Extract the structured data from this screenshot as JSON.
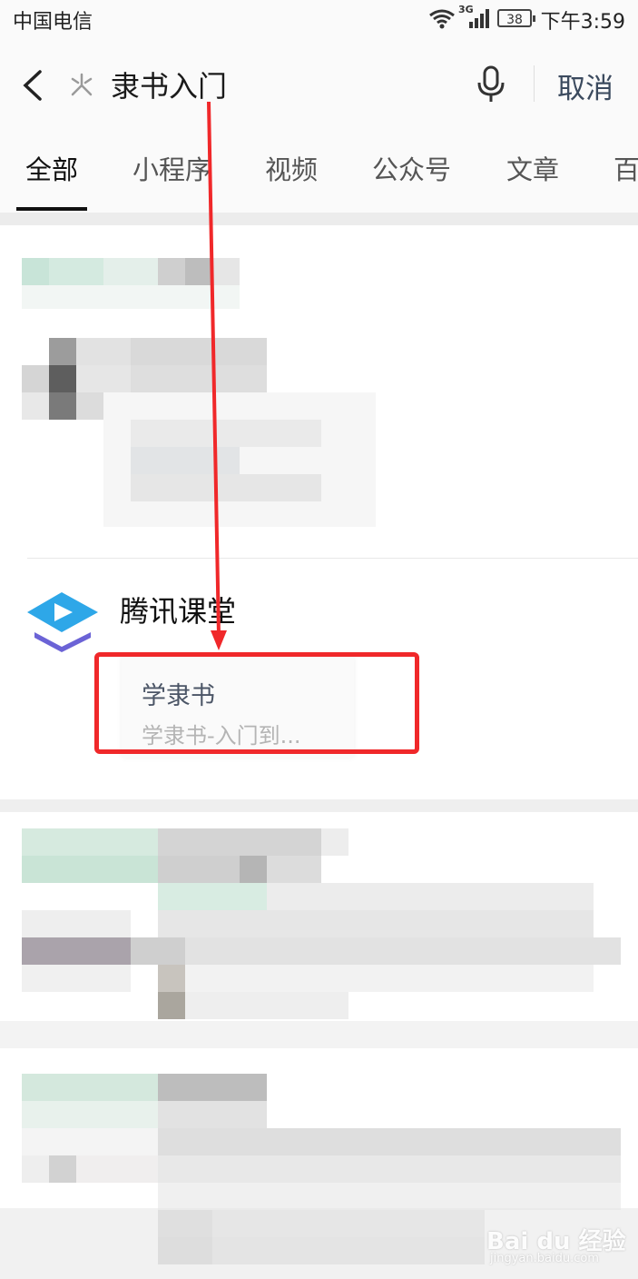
{
  "status_bar": {
    "carrier": "中国电信",
    "network": "3G",
    "battery": "38",
    "time": "下午3:59"
  },
  "search": {
    "query": "隶书入门",
    "cancel_label": "取消",
    "icons": [
      "back-icon",
      "miniapp-icon",
      "mic-icon"
    ]
  },
  "tabs": [
    {
      "label": "全部",
      "active": true
    },
    {
      "label": "小程序",
      "active": false
    },
    {
      "label": "视频",
      "active": false
    },
    {
      "label": "公众号",
      "active": false
    },
    {
      "label": "文章",
      "active": false
    },
    {
      "label": "百",
      "active": false
    }
  ],
  "result": {
    "app_name": "腾讯课堂",
    "item_title": "学隶书",
    "item_desc": "学隶书-入门到..."
  },
  "watermark": {
    "text": "Bai du 经验",
    "sub": "jingyan.baidu.com"
  },
  "colors": {
    "annotation": "#f0282a",
    "logo_blue": "#2ea7e8",
    "logo_purple": "#6b63d6"
  }
}
